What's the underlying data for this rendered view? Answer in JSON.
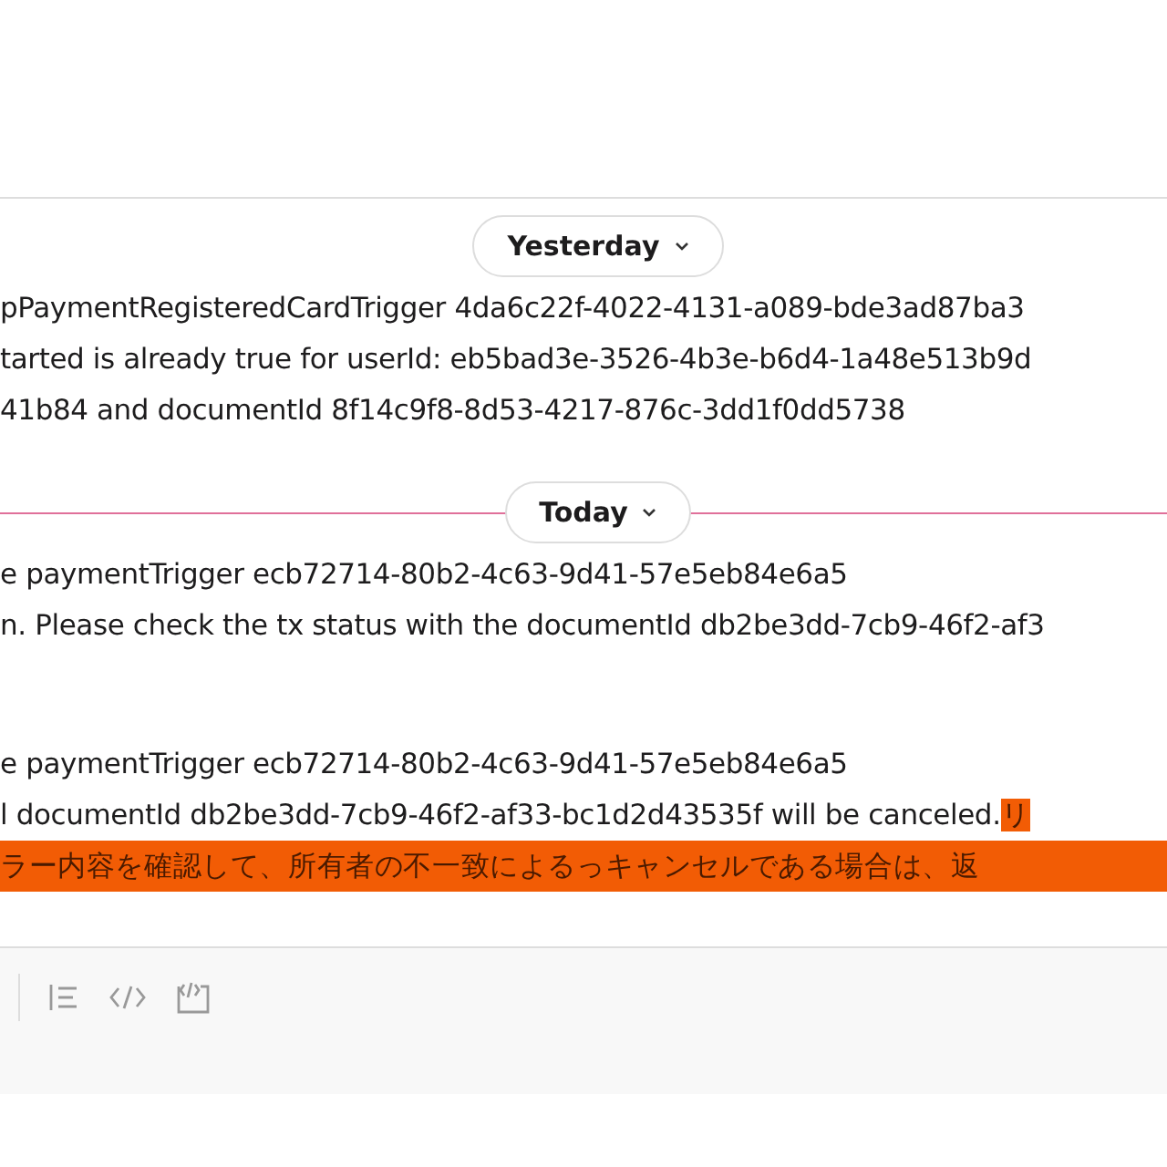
{
  "sections": [
    {
      "divider": {
        "label": "Yesterday",
        "new": false
      },
      "messages": [
        {
          "lines": [
            {
              "segments": [
                {
                  "text": "pPaymentRegisteredCardTrigger 4da6c22f-4022-4131-a089-bde3ad87ba3",
                  "marked": false
                }
              ]
            },
            {
              "segments": [
                {
                  "text": "tarted is already true for userId: eb5bad3e-3526-4b3e-b6d4-1a48e513b9d",
                  "marked": false
                }
              ]
            },
            {
              "segments": [
                {
                  "text": "41b84 and documentId 8f14c9f8-8d53-4217-876c-3dd1f0dd5738",
                  "marked": false
                }
              ]
            }
          ]
        }
      ]
    },
    {
      "divider": {
        "label": "Today",
        "new": true
      },
      "messages": [
        {
          "lines": [
            {
              "segments": [
                {
                  "text": "e  paymentTrigger ecb72714-80b2-4c63-9d41-57e5eb84e6a5",
                  "marked": false
                }
              ]
            },
            {
              "segments": [
                {
                  "text": "n. Please check the tx status with the documentId db2be3dd-7cb9-46f2-af3",
                  "marked": false
                }
              ]
            }
          ]
        },
        {
          "lines": [
            {
              "segments": [
                {
                  "text": "e  paymentTrigger ecb72714-80b2-4c63-9d41-57e5eb84e6a5",
                  "marked": false
                }
              ]
            },
            {
              "segments": [
                {
                  "text": "l documentId db2be3dd-7cb9-46f2-af33-bc1d2d43535f will be canceled.",
                  "marked": false
                },
                {
                  "text": "リ",
                  "marked": true
                }
              ]
            },
            {
              "segments": [
                {
                  "text": "ラー内容を確認して、所有者の不一致によるっキャンセルである場合は、返",
                  "marked": true
                }
              ]
            }
          ]
        }
      ]
    }
  ],
  "composer": {
    "tools": [
      {
        "kind": "list"
      },
      {
        "kind": "code"
      },
      {
        "kind": "code-block"
      }
    ]
  }
}
